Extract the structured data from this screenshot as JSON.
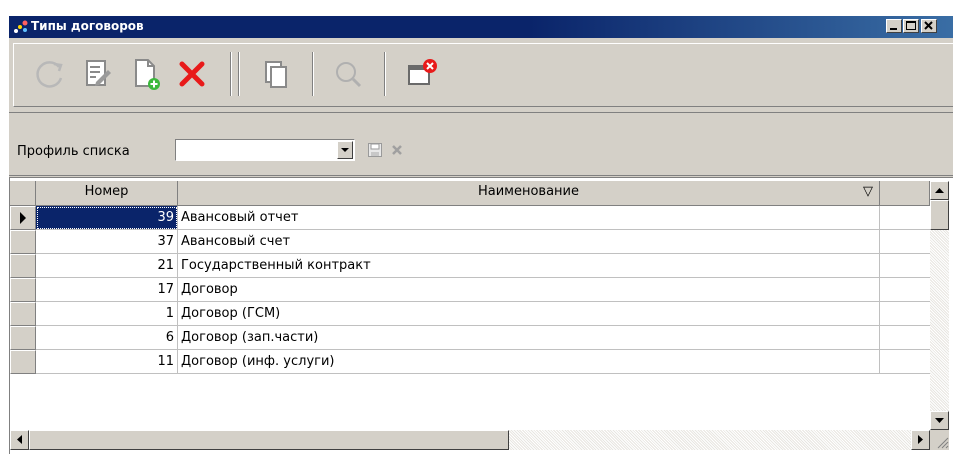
{
  "window": {
    "title": "Типы договоров",
    "controls": [
      "minimize",
      "maximize",
      "close"
    ]
  },
  "toolbar": {
    "buttons": [
      {
        "name": "refresh",
        "icon": "refresh-icon"
      },
      {
        "name": "edit",
        "icon": "edit-document-icon"
      },
      {
        "name": "create",
        "icon": "new-document-icon"
      },
      {
        "name": "delete",
        "icon": "red-x-icon"
      },
      {
        "name": "copy",
        "icon": "copy-icon"
      },
      {
        "name": "find",
        "icon": "search-icon"
      },
      {
        "name": "close",
        "icon": "close-window-icon"
      }
    ]
  },
  "profile": {
    "label": "Профиль списка",
    "value": "",
    "save_icon": "save-icon",
    "delete_icon": "delete-profile-icon"
  },
  "grid": {
    "columns": [
      {
        "label": "Номер"
      },
      {
        "label": "Наименование",
        "sort_indicator": "▽"
      }
    ],
    "rows": [
      {
        "number": "39",
        "name": "Авансовый отчет",
        "selected": true
      },
      {
        "number": "37",
        "name": "Авансовый счет"
      },
      {
        "number": "21",
        "name": "Государственный контракт"
      },
      {
        "number": "17",
        "name": "Договор"
      },
      {
        "number": "1",
        "name": "Договор (ГСМ)"
      },
      {
        "number": "6",
        "name": "Договор (зап.части)"
      },
      {
        "number": "11",
        "name": "Договор (инф. услуги)"
      }
    ]
  },
  "colors": {
    "title_bar": "#0a246a",
    "window_face": "#d4d0c8",
    "selection": "#0a246a",
    "delete_red": "#e81a1a"
  }
}
